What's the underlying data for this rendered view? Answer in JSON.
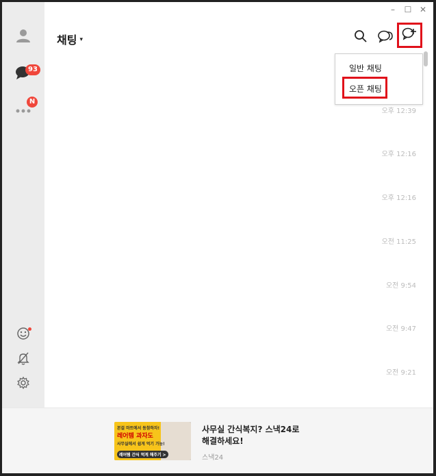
{
  "window": {
    "controls": {
      "minimize": "–",
      "maximize": "☐",
      "close": "✕"
    }
  },
  "sidebar": {
    "items": [
      {
        "name": "friends",
        "icon": "person-icon"
      },
      {
        "name": "chats",
        "icon": "chat-bubble-icon",
        "badge": "93"
      },
      {
        "name": "more",
        "icon": "more-dots-icon",
        "badge": "N"
      }
    ],
    "bottom": [
      {
        "name": "emoticon",
        "icon": "smiley-icon",
        "has_dot": true
      },
      {
        "name": "notifications",
        "icon": "bell-off-icon"
      },
      {
        "name": "settings",
        "icon": "gear-icon"
      }
    ]
  },
  "header": {
    "title": "채팅",
    "caret": "▾"
  },
  "dropdown": {
    "items": [
      "일반 채팅",
      "오픈 채팅"
    ]
  },
  "chat_list": {
    "timestamps": [
      "오후 12:39",
      "오후 12:16",
      "오후 12:16",
      "오전 11:25",
      "오전 9:54",
      "오전 9:47",
      "오전 9:21"
    ]
  },
  "ad": {
    "title_line1": "사무실 간식복지? 스낵24로",
    "title_line2": "해결하세요!",
    "sponsor": "스낵24",
    "image_text_1": "본걸 마트에서 동참하자!",
    "image_text_2": "레어템 과자도",
    "image_text_3": "사무실에서 쉽게 먹기 가능!",
    "image_text_4": "레어템 간식 먹게 해주기 >"
  },
  "colors": {
    "sidebar_bg": "#ececec",
    "badge": "#f0473b",
    "highlight_box": "#e0101a",
    "timestamp": "#bbbbbb"
  }
}
